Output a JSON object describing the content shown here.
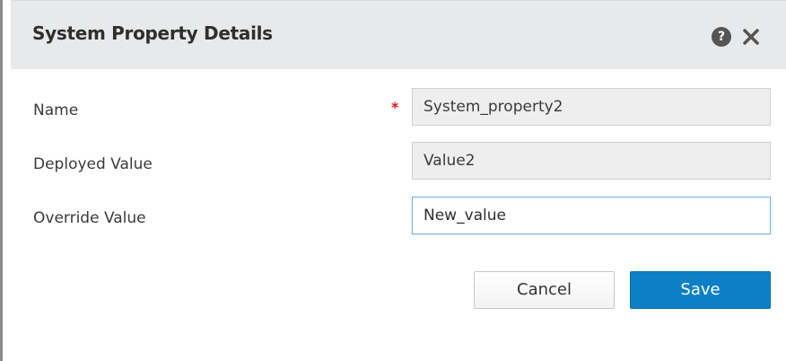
{
  "dialog": {
    "title": "System Property Details",
    "help_icon": "question-circle-icon",
    "close_icon": "close-x-icon"
  },
  "form": {
    "name": {
      "label": "Name",
      "required_marker": "*",
      "value": "System_property2"
    },
    "deployed_value": {
      "label": "Deployed Value",
      "value": "Value2"
    },
    "override_value": {
      "label": "Override Value",
      "value": "New_value"
    }
  },
  "buttons": {
    "cancel": "Cancel",
    "save": "Save"
  },
  "colors": {
    "header_bg": "#e8e9ea",
    "required": "#e01818",
    "primary": "#0d7fc6"
  }
}
